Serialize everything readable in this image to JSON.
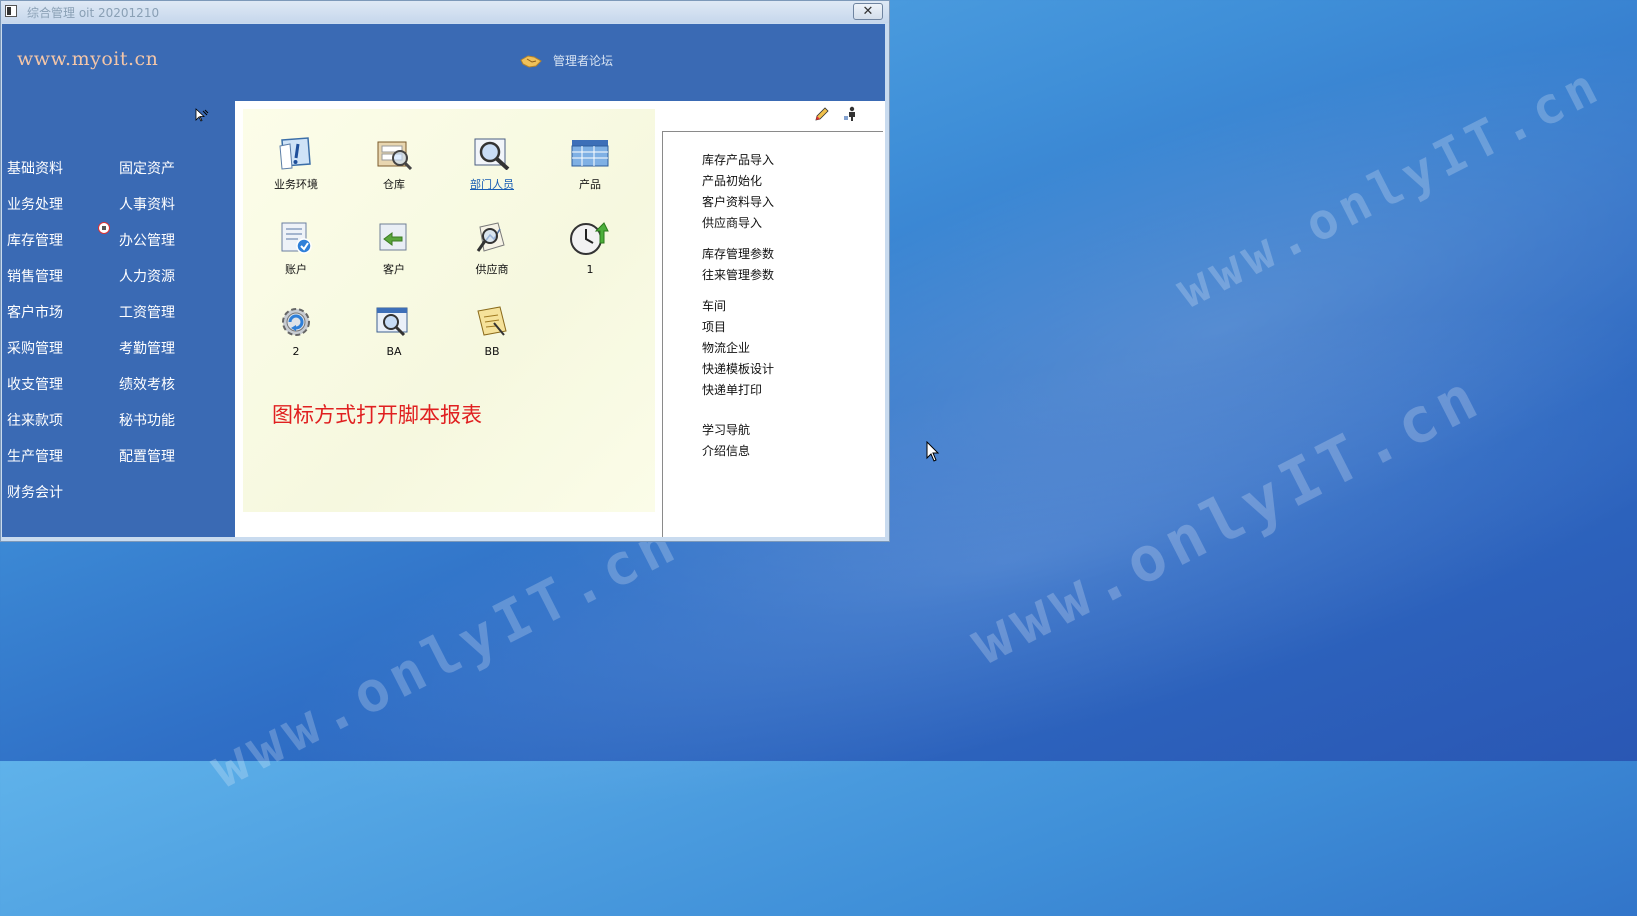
{
  "window": {
    "title": "综合管理 oit 20201210",
    "close_label": "✕"
  },
  "header": {
    "site_url": "www.myoit.cn",
    "forum_link": "管理者论坛"
  },
  "sidebar": {
    "left_column": [
      "基础资料",
      "业务处理",
      "库存管理",
      "销售管理",
      "客户市场",
      "采购管理",
      "收支管理",
      "往来款项",
      "生产管理",
      "财务会计"
    ],
    "right_column": [
      "固定资产",
      "人事资料",
      "办公管理",
      "人力资源",
      "工资管理",
      "考勤管理",
      "绩效考核",
      "秘书功能",
      "配置管理"
    ]
  },
  "tiles": [
    {
      "label": "业务环境",
      "icon": "business-environment-icon"
    },
    {
      "label": "仓库",
      "icon": "warehouse-icon"
    },
    {
      "label": "部门人员",
      "icon": "department-staff-icon",
      "hovered": true
    },
    {
      "label": "产品",
      "icon": "product-icon"
    },
    {
      "label": "账户",
      "icon": "account-icon"
    },
    {
      "label": "客户",
      "icon": "customer-icon"
    },
    {
      "label": "供应商",
      "icon": "supplier-icon"
    },
    {
      "label": "1",
      "icon": "clock-icon"
    },
    {
      "label": "2",
      "icon": "gear-refresh-icon"
    },
    {
      "label": "BA",
      "icon": "report-ba-icon"
    },
    {
      "label": "BB",
      "icon": "report-bb-icon"
    }
  ],
  "script_note": "图标方式打开脚本报表",
  "quick_links": {
    "group1": [
      "库存产品导入",
      "产品初始化",
      "客户资料导入",
      "供应商导入"
    ],
    "group2": [
      "库存管理参数",
      "往来管理参数"
    ],
    "group3": [
      "车间",
      "项目",
      "物流企业",
      "快递模板设计",
      "快递单打印"
    ],
    "group4": [
      "学习导航",
      "介绍信息"
    ]
  },
  "desktop": {
    "watermarks": [
      "www.onlyIT.cn",
      "www.onlyIT.cn",
      "www.onlyIT.cn"
    ]
  },
  "colors": {
    "header_bg": "#3a6ab4",
    "note_red": "#e02020",
    "link_blue": "#1a5fb4"
  }
}
